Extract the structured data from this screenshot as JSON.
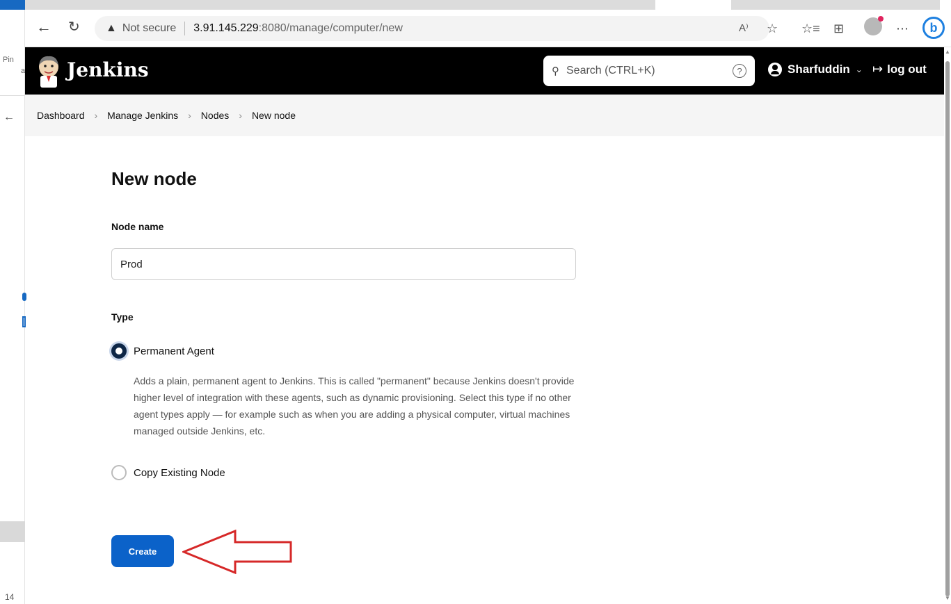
{
  "browser": {
    "not_secure_label": "Not secure",
    "url_host": "3.91.145.229",
    "url_path": ":8080/manage/computer/new",
    "left_strip_pin": "Pin",
    "left_strip_bottom": "14"
  },
  "header": {
    "title": "Jenkins",
    "search_placeholder": "Search (CTRL+K)",
    "help_glyph": "?",
    "user_name": "Sharfuddin",
    "logout_label": "log out"
  },
  "breadcrumb": [
    "Dashboard",
    "Manage Jenkins",
    "Nodes",
    "New node"
  ],
  "form": {
    "page_title": "New node",
    "node_name_label": "Node name",
    "node_name_value": "Prod",
    "type_label": "Type",
    "options": [
      {
        "label": "Permanent Agent",
        "selected": true
      },
      {
        "label": "Copy Existing Node",
        "selected": false
      }
    ],
    "permanent_description": "Adds a plain, permanent agent to Jenkins. This is called \"permanent\" because Jenkins doesn't provide higher level of integration with these agents, such as dynamic provisioning. Select this type if no other agent types apply — for example such as when you are adding a physical computer, virtual machines managed outside Jenkins, etc.",
    "create_label": "Create"
  },
  "colors": {
    "header_bg": "#000000",
    "primary_button": "#0b62c9",
    "annotation_arrow": "#d62828"
  }
}
